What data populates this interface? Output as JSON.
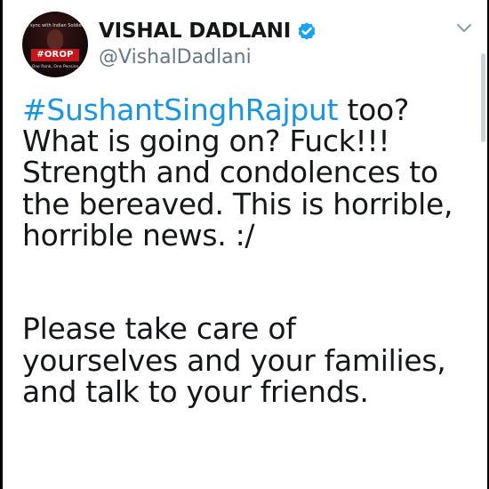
{
  "tweet": {
    "avatar": {
      "caption": "In sync with Indian Soldiers",
      "badge": "#OROP",
      "sub_caption": "One Rank, One Pension"
    },
    "author": {
      "display_name": "VISHAL DADLANI",
      "handle": "@VishalDadlani",
      "verified": true
    },
    "body": {
      "hashtag": "#SushantSinghRajput",
      "line1_rest": " too?",
      "line2": "What is going on? Fuck!!!",
      "line3": "Strength and condolences to",
      "line4": "the bereaved. This is horrible,",
      "line5": "horrible news. :/",
      "line6": "Please take care of",
      "line7": "yourselves and your families,",
      "line8": "and talk to your friends."
    }
  },
  "colors": {
    "hashtag": "#1b95e0",
    "verified_badge": "#1da1f2",
    "handle": "#657786",
    "text": "#14171a"
  },
  "icons": {
    "verified": "verified-badge-icon",
    "menu": "chevron-down-icon"
  }
}
